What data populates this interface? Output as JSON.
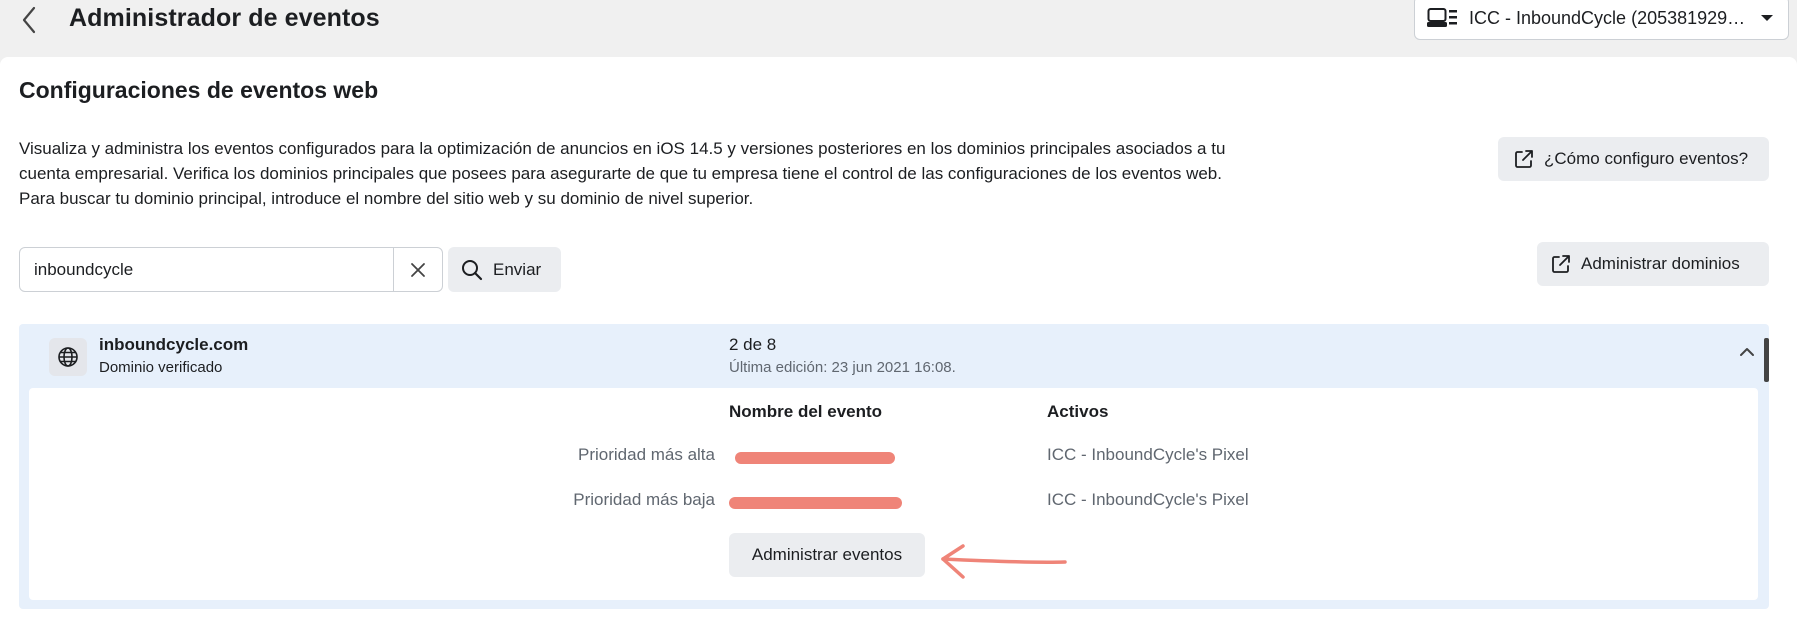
{
  "header": {
    "title": "Administrador de eventos",
    "account_label": "ICC - InboundCycle (2053819298..."
  },
  "section": {
    "title": "Configuraciones de eventos web",
    "description_lines": [
      "Visualiza y administra los eventos configurados para la optimización de anuncios en iOS 14.5 y versiones posteriores en los dominios principales asociados a tu",
      "cuenta empresarial. Verifica los dominios principales que posees para asegurarte de que tu empresa tiene el control de las configuraciones de los eventos web.",
      "Para buscar tu dominio principal, introduce el nombre del sitio web y su dominio de nivel superior."
    ],
    "howto_button": "¿Cómo configuro eventos?",
    "manage_domains_button": "Administrar dominios"
  },
  "search": {
    "value": "inboundcycle",
    "submit_label": "Enviar"
  },
  "domain": {
    "name": "inboundcycle.com",
    "status": "Dominio verificado",
    "count": "2 de 8",
    "last_edit": "Última edición: 23 jun 2021 16:08.",
    "table": {
      "col_event": "Nombre del evento",
      "col_assets": "Activos",
      "rows": [
        {
          "label": "Prioridad más alta",
          "asset": "ICC - InboundCycle's Pixel"
        },
        {
          "label": "Prioridad más baja",
          "asset": "ICC - InboundCycle's Pixel"
        }
      ]
    },
    "manage_events_button": "Administrar eventos"
  },
  "colors": {
    "redaction": "#ef8478",
    "panel": "#e7f0fb",
    "button_bg": "#ebedf0"
  },
  "icons": [
    "chevron-left-icon",
    "account-icon",
    "caret-down-icon",
    "external-link-icon",
    "close-icon",
    "search-icon",
    "globe-icon",
    "chevron-up-icon",
    "arrow-left-icon"
  ]
}
